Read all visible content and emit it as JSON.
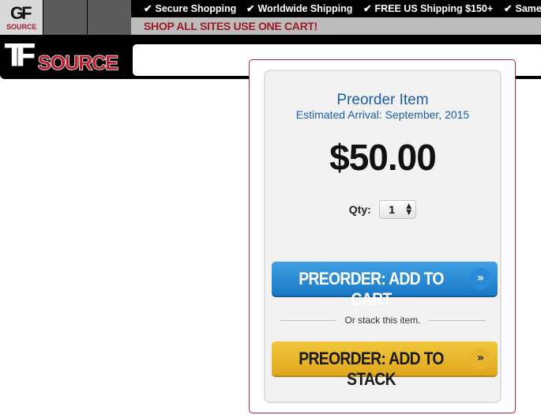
{
  "topbar": {
    "mini_logo": {
      "letters": "GF",
      "name": "SOURCE"
    },
    "benefits": [
      "Secure Shopping",
      "Worldwide Shipping",
      "FREE US Shipping $150+",
      "Same"
    ],
    "promo": "SHOP ALL SITES USE ONE CART!"
  },
  "header": {
    "logo": {
      "letters": "TF",
      "name": "SOURCE"
    },
    "search": {
      "value": ""
    }
  },
  "product": {
    "status": "Preorder Item",
    "arrival": "Estimated Arrival: September, 2015",
    "price": "$50.00",
    "qty_label": "Qty:",
    "qty_value": "1",
    "add_to_cart_label": "PREORDER: ADD TO CART",
    "stack_divider": "Or stack this item.",
    "add_to_stack_label": "PREORDER: ADD TO STACK",
    "button_icon": "double-chevron-right-icon"
  },
  "colors": {
    "brand_red": "#9b1b28",
    "link_blue": "#1a5ea8",
    "cart_button": "#2a8ad6",
    "stack_button": "#e9b632"
  }
}
